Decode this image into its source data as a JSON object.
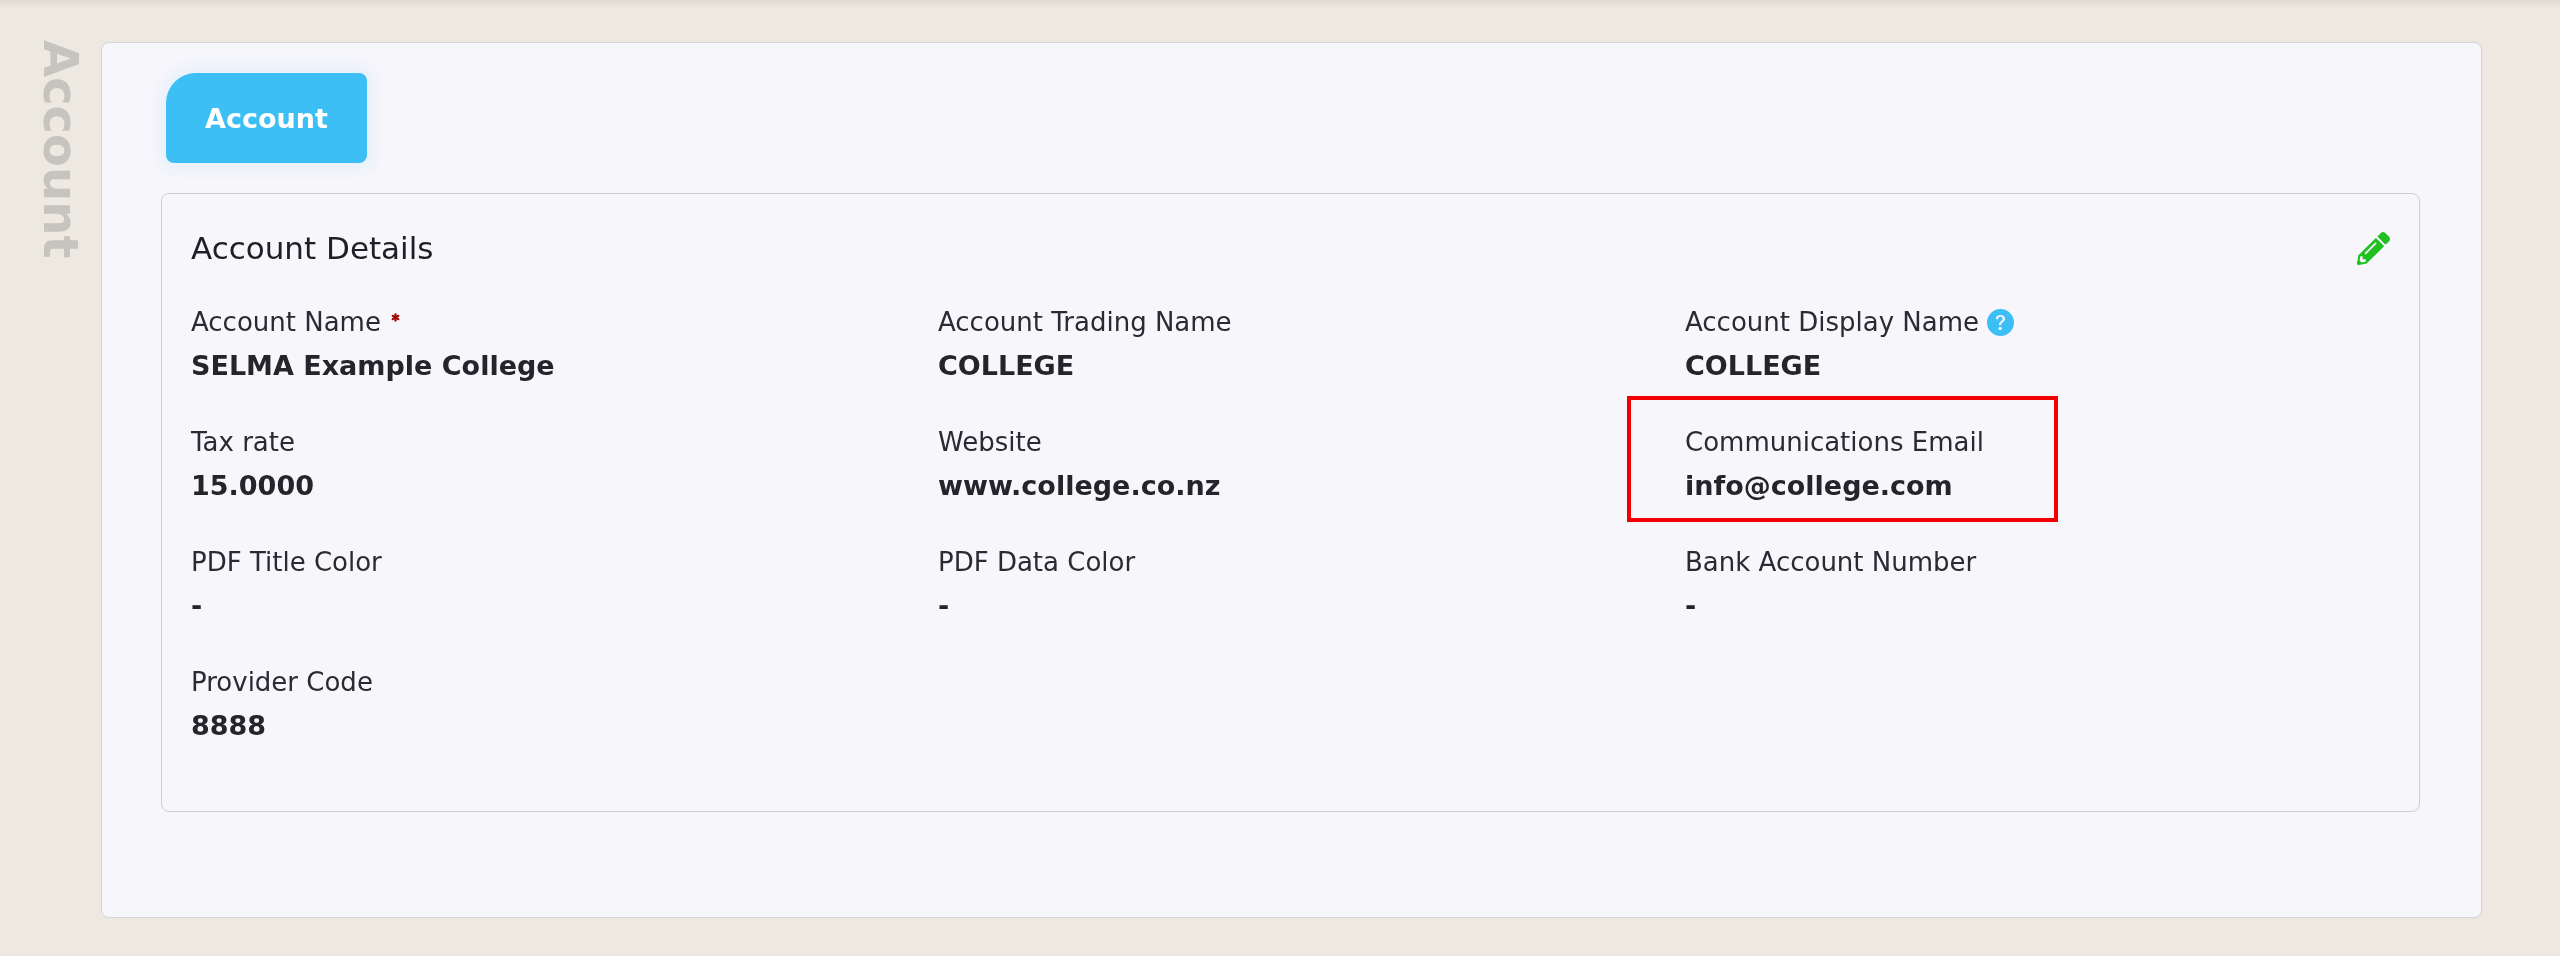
{
  "page_title": "Account",
  "tabs": [
    {
      "label": "Account",
      "selected": true
    }
  ],
  "details": {
    "title": "Account Details",
    "fields": [
      {
        "label": "Account Name",
        "value": "SELMA Example College",
        "required": true,
        "help": false,
        "highlighted": false
      },
      {
        "label": "Account Trading Name",
        "value": "COLLEGE",
        "required": false,
        "help": false,
        "highlighted": false
      },
      {
        "label": "Account Display Name",
        "value": "COLLEGE",
        "required": false,
        "help": true,
        "highlighted": false
      },
      {
        "label": "Tax rate",
        "value": "15.0000",
        "required": false,
        "help": false,
        "highlighted": false
      },
      {
        "label": "Website",
        "value": "www.college.co.nz",
        "required": false,
        "help": false,
        "highlighted": false
      },
      {
        "label": "Communications Email",
        "value": "info@college.com",
        "required": false,
        "help": false,
        "highlighted": true
      },
      {
        "label": "PDF Title Color",
        "value": "-",
        "required": false,
        "help": false,
        "highlighted": false
      },
      {
        "label": "PDF Data Color",
        "value": "-",
        "required": false,
        "help": false,
        "highlighted": false
      },
      {
        "label": "Bank Account Number",
        "value": "-",
        "required": false,
        "help": false,
        "highlighted": false
      },
      {
        "label": "Provider Code",
        "value": "8888",
        "required": false,
        "help": false,
        "highlighted": false
      }
    ]
  }
}
